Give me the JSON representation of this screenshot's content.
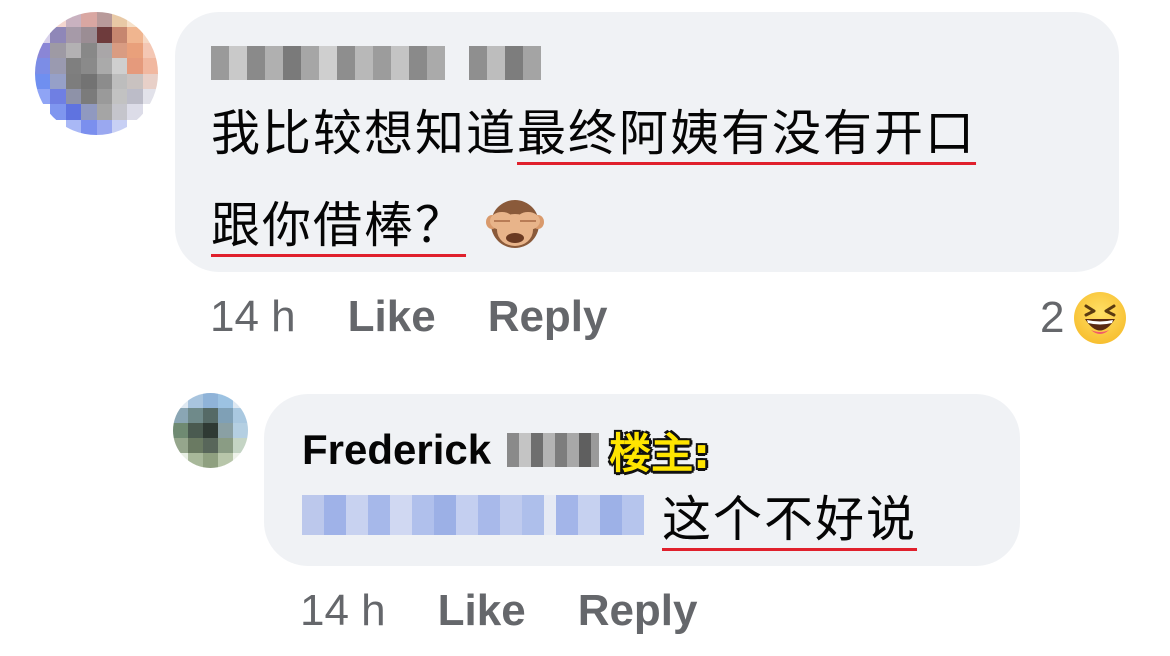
{
  "comments": [
    {
      "avatar": "pixelated-avatar",
      "author_blurred": true,
      "text_line1_plain": "我比较想知道",
      "text_line1_underlined": "最终阿姨有没有开口",
      "text_line2_underlined": "跟你借棒？",
      "emoji": "see-no-evil-monkey",
      "time": "14 h",
      "like_label": "Like",
      "reply_label": "Reply",
      "reaction_count": "2",
      "reaction_icon": "haha-emoji"
    },
    {
      "avatar": "pixelated-avatar",
      "author_name": "Frederick",
      "author_surname_blurred": true,
      "badge": "楼主:",
      "text_blurred": true,
      "text_underlined": "这个不好说",
      "time": "14 h",
      "like_label": "Like",
      "reply_label": "Reply"
    }
  ],
  "colors": {
    "bubble": "#f0f2f5",
    "underline": "#e0202c",
    "action_text": "#65676b",
    "badge": "#ffe500"
  }
}
